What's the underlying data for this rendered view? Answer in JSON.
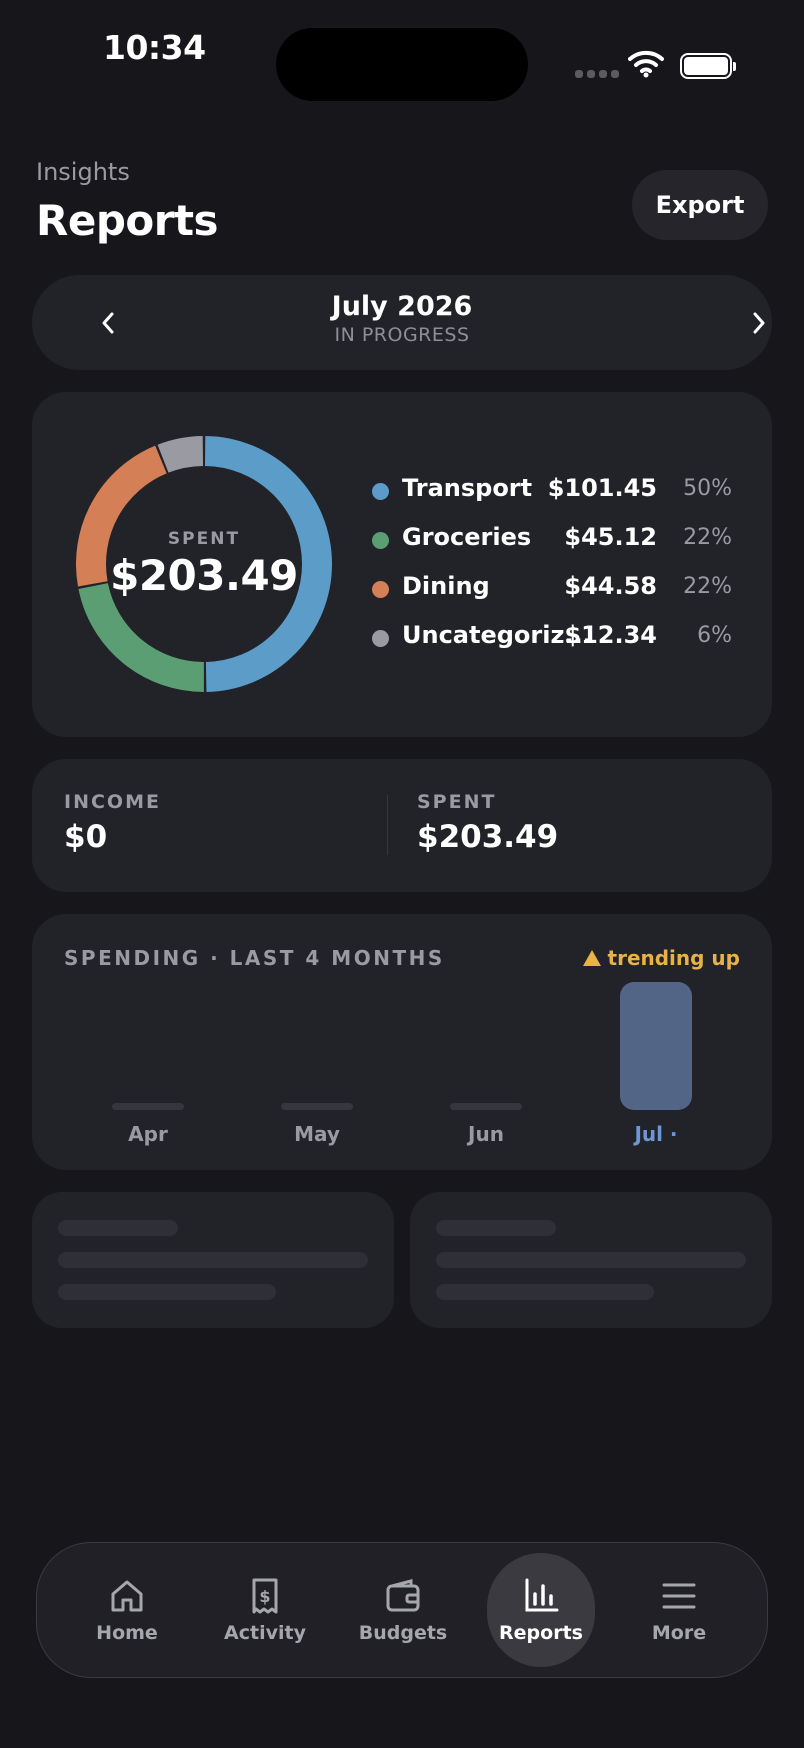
{
  "status_bar": {
    "time": "10:34"
  },
  "header": {
    "overline": "Insights",
    "title": "Reports",
    "export_label": "Export"
  },
  "month_selector": {
    "month": "July 2026",
    "status": "IN PROGRESS"
  },
  "donut": {
    "caption": "SPENT",
    "total": "$203.49",
    "categories": [
      {
        "name": "Transport",
        "amount": "$101.45",
        "percent": "50%",
        "color": "#5b9cc8"
      },
      {
        "name": "Groceries",
        "amount": "$45.12",
        "percent": "22%",
        "color": "#5b9e73"
      },
      {
        "name": "Dining",
        "amount": "$44.58",
        "percent": "22%",
        "color": "#d47f55"
      },
      {
        "name": "Uncategoriz...",
        "amount": "$12.34",
        "percent": "6%",
        "color": "#9a9aa3"
      }
    ]
  },
  "totals": {
    "income_label": "INCOME",
    "income_value": "$0",
    "spent_label": "SPENT",
    "spent_value": "$203.49"
  },
  "spending": {
    "title": "SPENDING · LAST 4 MONTHS",
    "trend_label": "trending up",
    "trend_color": "#e8b14a",
    "months": [
      {
        "label": "Apr",
        "value": 0,
        "active": false
      },
      {
        "label": "May",
        "value": 0,
        "active": false
      },
      {
        "label": "Jun",
        "value": 0,
        "active": false
      },
      {
        "label": "Jul ·",
        "value": 203.49,
        "active": true
      }
    ]
  },
  "tab_bar": {
    "tabs": [
      {
        "label": "Home",
        "icon": "home-icon",
        "active": false
      },
      {
        "label": "Activity",
        "icon": "receipt-icon",
        "active": false
      },
      {
        "label": "Budgets",
        "icon": "wallet-icon",
        "active": false
      },
      {
        "label": "Reports",
        "icon": "bar-chart-icon",
        "active": true
      },
      {
        "label": "More",
        "icon": "menu-icon",
        "active": false
      }
    ]
  }
}
